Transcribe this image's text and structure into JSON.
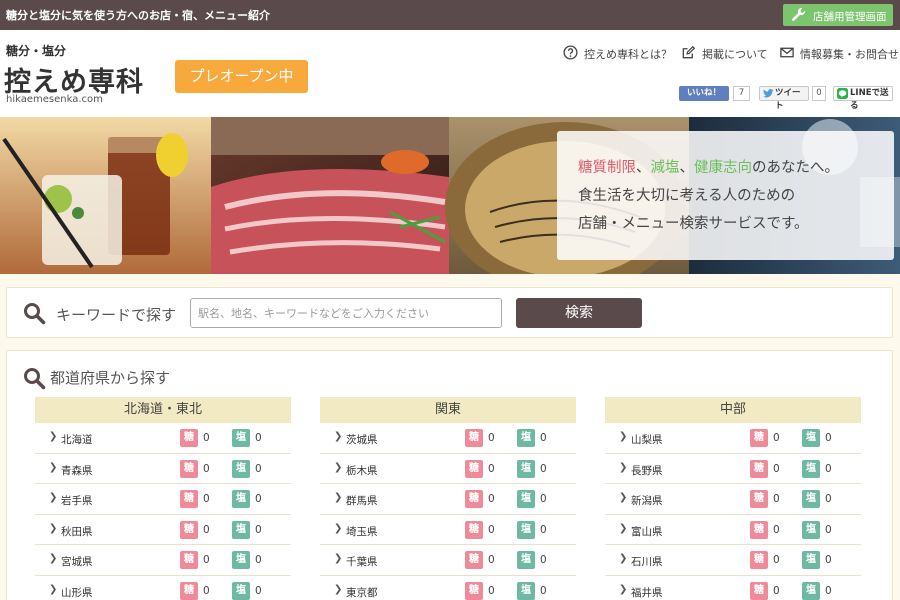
{
  "topbar": {
    "tagline": "糖分と塩分に気を使う方へのお店・宿、メニュー紹介",
    "admin_label": "店舗用管理画面"
  },
  "header": {
    "logo_sub": "糖分・塩分",
    "logo_main": "控えめ専科",
    "logo_url": "hikaemesenka.com",
    "preopen_label": "プレオープン中",
    "nav": [
      {
        "label": "控えめ専科とは？",
        "icon": "help-circle-icon"
      },
      {
        "label": "掲載について",
        "icon": "edit-icon"
      },
      {
        "label": "情報募集・お問合せ",
        "icon": "mail-icon"
      }
    ],
    "social": {
      "like_label": "いいね！",
      "like_count": "7",
      "tweet_label": "ツイート",
      "tweet_count": "0",
      "line_label": "LINEで送る"
    }
  },
  "hero": {
    "line1_a": "糖質制限",
    "line1_b": "、",
    "line1_c": "減塩",
    "line1_d": "、",
    "line1_e": "健康志向",
    "line1_f": "のあなたへ。",
    "line2": "食生活を大切に考える人のための",
    "line3": "店舗・メニュー検索サービスです。"
  },
  "search": {
    "label": "キーワードで探す",
    "placeholder": "駅名、地名、キーワードなどをご入力ください",
    "value": "",
    "button_label": "検索"
  },
  "prefectures": {
    "title": "都道府県から探す",
    "sugar_badge": "糖",
    "salt_badge": "塩",
    "regions": [
      {
        "name": "北海道・東北",
        "items": [
          {
            "name": "北海道",
            "sugar": "0",
            "salt": "0"
          },
          {
            "name": "青森県",
            "sugar": "0",
            "salt": "0"
          },
          {
            "name": "岩手県",
            "sugar": "0",
            "salt": "0"
          },
          {
            "name": "秋田県",
            "sugar": "0",
            "salt": "0"
          },
          {
            "name": "宮城県",
            "sugar": "0",
            "salt": "0"
          },
          {
            "name": "山形県",
            "sugar": "0",
            "salt": "0"
          }
        ]
      },
      {
        "name": "関東",
        "items": [
          {
            "name": "茨城県",
            "sugar": "0",
            "salt": "0"
          },
          {
            "name": "栃木県",
            "sugar": "0",
            "salt": "0"
          },
          {
            "name": "群馬県",
            "sugar": "0",
            "salt": "0"
          },
          {
            "name": "埼玉県",
            "sugar": "0",
            "salt": "0"
          },
          {
            "name": "千葉県",
            "sugar": "0",
            "salt": "0"
          },
          {
            "name": "東京都",
            "sugar": "0",
            "salt": "0"
          }
        ]
      },
      {
        "name": "中部",
        "items": [
          {
            "name": "山梨県",
            "sugar": "0",
            "salt": "0"
          },
          {
            "name": "長野県",
            "sugar": "0",
            "salt": "0"
          },
          {
            "name": "新潟県",
            "sugar": "0",
            "salt": "0"
          },
          {
            "name": "富山県",
            "sugar": "0",
            "salt": "0"
          },
          {
            "name": "石川県",
            "sugar": "0",
            "salt": "0"
          },
          {
            "name": "福井県",
            "sugar": "0",
            "salt": "0"
          }
        ]
      }
    ]
  }
}
